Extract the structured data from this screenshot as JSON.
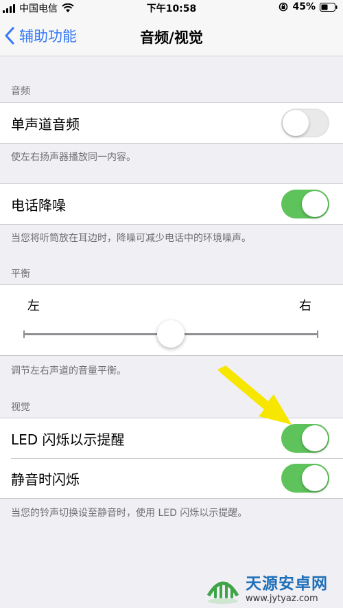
{
  "status_bar": {
    "carrier": "中国电信",
    "time": "下午10:58",
    "battery": "45%"
  },
  "nav": {
    "back_label": "辅助功能",
    "title": "音频/视觉"
  },
  "sections": {
    "audio": {
      "header": "音频",
      "mono_audio": {
        "label": "单声道音频",
        "on": false
      },
      "mono_footer": "使左右扬声器播放同一内容。",
      "phone_noise": {
        "label": "电话降噪",
        "on": true
      },
      "phone_noise_footer": "当您将听筒放在耳边时，降噪可减少电话中的环境噪声。"
    },
    "balance": {
      "header": "平衡",
      "left_label": "左",
      "right_label": "右",
      "value": 0.5,
      "footer": "调节左右声道的音量平衡。"
    },
    "visual": {
      "header": "视觉",
      "led_flash": {
        "label": "LED 闪烁以示提醒",
        "on": true
      },
      "flash_silent": {
        "label": "静音时闪烁",
        "on": true
      },
      "footer": "当您的铃声切换设至静音时，使用 LED 闪烁以示提醒。"
    }
  },
  "watermark": {
    "title": "天源安卓网",
    "url": "www.jytyaz.com"
  },
  "colors": {
    "accent": "#3478f6",
    "toggle_on": "#5dc35a",
    "annotation_arrow": "#f7e600"
  },
  "icons": [
    "signal-icon",
    "wifi-icon",
    "rotation-lock-icon",
    "battery-icon",
    "back-chevron-icon",
    "arrow-annotation-icon"
  ]
}
